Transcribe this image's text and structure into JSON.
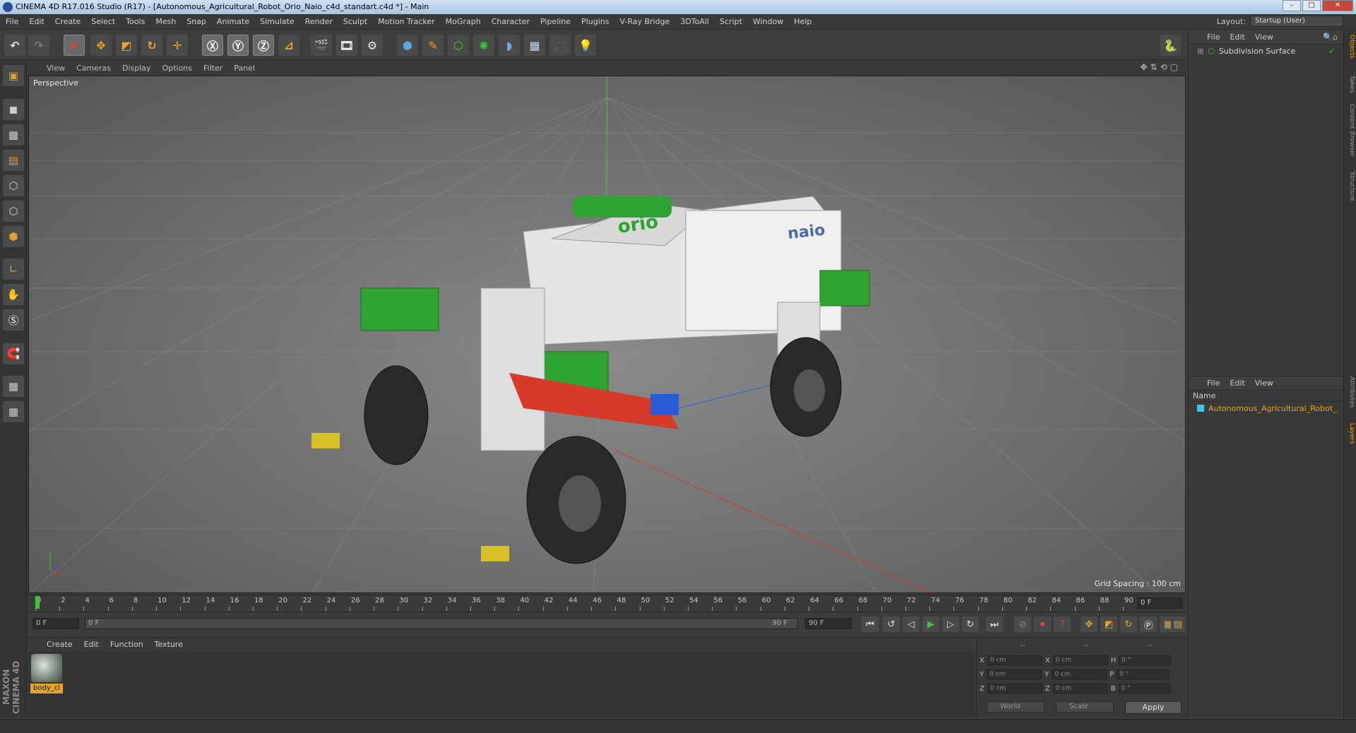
{
  "window": {
    "title": "CINEMA 4D R17.016 Studio (R17) - [Autonomous_Agricultural_Robot_Orio_Naio_c4d_standart.c4d *] - Main"
  },
  "menu": [
    "File",
    "Edit",
    "Create",
    "Select",
    "Tools",
    "Mesh",
    "Snap",
    "Animate",
    "Simulate",
    "Render",
    "Sculpt",
    "Motion Tracker",
    "MoGraph",
    "Character",
    "Pipeline",
    "Plugins",
    "V-Ray Bridge",
    "3DToAll",
    "Script",
    "Window",
    "Help"
  ],
  "layout": {
    "label": "Layout:",
    "value": "Startup (User)"
  },
  "viewport": {
    "menu": [
      "View",
      "Cameras",
      "Display",
      "Options",
      "Filter",
      "Panel"
    ],
    "label": "Perspective",
    "grid_spacing": "Grid Spacing : 100 cm"
  },
  "objects_panel": {
    "menu": [
      "File",
      "Edit",
      "View"
    ],
    "items": [
      {
        "name": "Subdivision Surface"
      }
    ]
  },
  "layers_panel": {
    "menu": [
      "File",
      "Edit",
      "View"
    ],
    "column": "Name",
    "items": [
      {
        "name": "Autonomous_Agricultural_Robot_"
      }
    ]
  },
  "side_tabs": [
    "Objects",
    "Takes",
    "Content Browser",
    "Structure",
    "Attributes",
    "Layers"
  ],
  "timeline": {
    "ticks": [
      "0",
      "2",
      "4",
      "6",
      "8",
      "10",
      "12",
      "14",
      "16",
      "18",
      "20",
      "22",
      "24",
      "26",
      "28",
      "30",
      "32",
      "34",
      "36",
      "38",
      "40",
      "42",
      "44",
      "46",
      "48",
      "50",
      "52",
      "54",
      "56",
      "58",
      "60",
      "62",
      "64",
      "66",
      "68",
      "70",
      "72",
      "74",
      "76",
      "78",
      "80",
      "82",
      "84",
      "86",
      "88",
      "90"
    ],
    "current_frame": "0 F"
  },
  "transport": {
    "start": "0 F",
    "range_start": "0 F",
    "range_end": "90 F",
    "end": "90 F"
  },
  "materials": {
    "menu": [
      "Create",
      "Edit",
      "Function",
      "Texture"
    ],
    "items": [
      {
        "name": "body_cl"
      }
    ]
  },
  "coordinates": {
    "header": [
      "--",
      "--",
      "--"
    ],
    "rows": [
      {
        "a": "X",
        "v1": "0 cm",
        "b": "X",
        "v2": "0 cm",
        "c": "H",
        "v3": "0 °"
      },
      {
        "a": "Y",
        "v1": "0 cm",
        "b": "Y",
        "v2": "0 cm",
        "c": "P",
        "v3": "0 °"
      },
      {
        "a": "Z",
        "v1": "0 cm",
        "b": "Z",
        "v2": "0 cm",
        "c": "B",
        "v3": "0 °"
      }
    ],
    "mode1": "World",
    "mode2": "Scale",
    "apply": "Apply"
  },
  "logo": "MAXON CINEMA 4D",
  "colors": {
    "accent": "#e6a52a",
    "playhead": "#3cc63c",
    "model_green": "#2fa32f",
    "model_red": "#d63a2a"
  }
}
